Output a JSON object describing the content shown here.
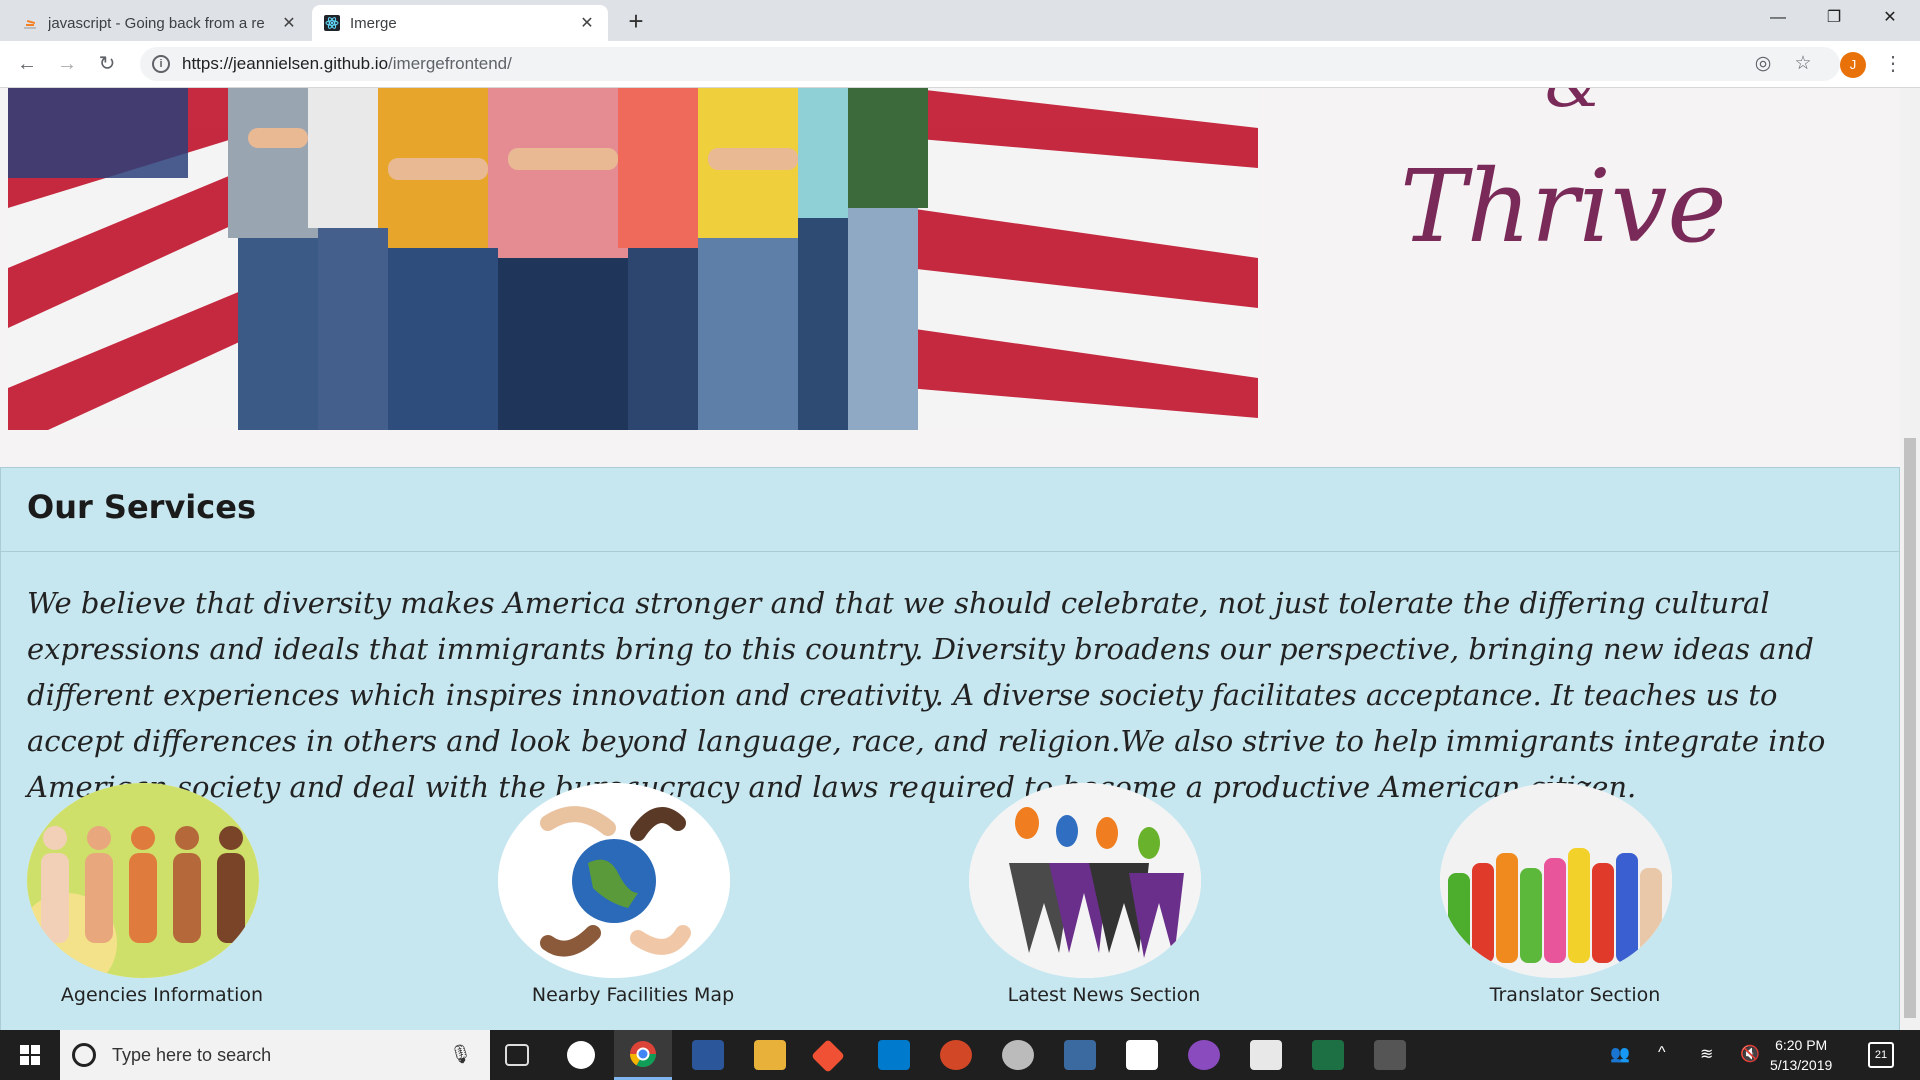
{
  "browser": {
    "tabs": [
      {
        "title": "javascript - Going back from a re",
        "active": false
      },
      {
        "title": "Imerge",
        "active": true
      }
    ],
    "url_host": "https://jeannielsen.github.io",
    "url_path": "/imergefrontend/",
    "avatar_letter": "J"
  },
  "hero": {
    "thrive_text": "Thrive",
    "amp_text": "&"
  },
  "services": {
    "title": "Our Services",
    "description": "We believe that diversity makes America stronger and that we should celebrate, not just tolerate the differing cultural expressions and ideals that immigrants bring to this country. Diversity broadens our perspective, bringing new ideas and different experiences which inspires innovation and creativity. A diverse society facilitates acceptance. It teaches us to accept differences in others and look beyond language, race, and religion.We also strive to help immigrants integrate into American society and deal with the bureaucracy and laws required to become a productive American citizen.",
    "cards": [
      {
        "label": "Agencies Information"
      },
      {
        "label": "Nearby Facilities Map"
      },
      {
        "label": "Latest News Section"
      },
      {
        "label": "Translator Section"
      }
    ]
  },
  "taskbar": {
    "search_placeholder": "Type here to search",
    "time": "6:20 PM",
    "date": "5/13/2019",
    "notification_count": "21"
  },
  "colors": {
    "accent_purple": "#7a2a58",
    "services_bg": "#c7e7f0",
    "avatar_orange": "#e8710a"
  }
}
